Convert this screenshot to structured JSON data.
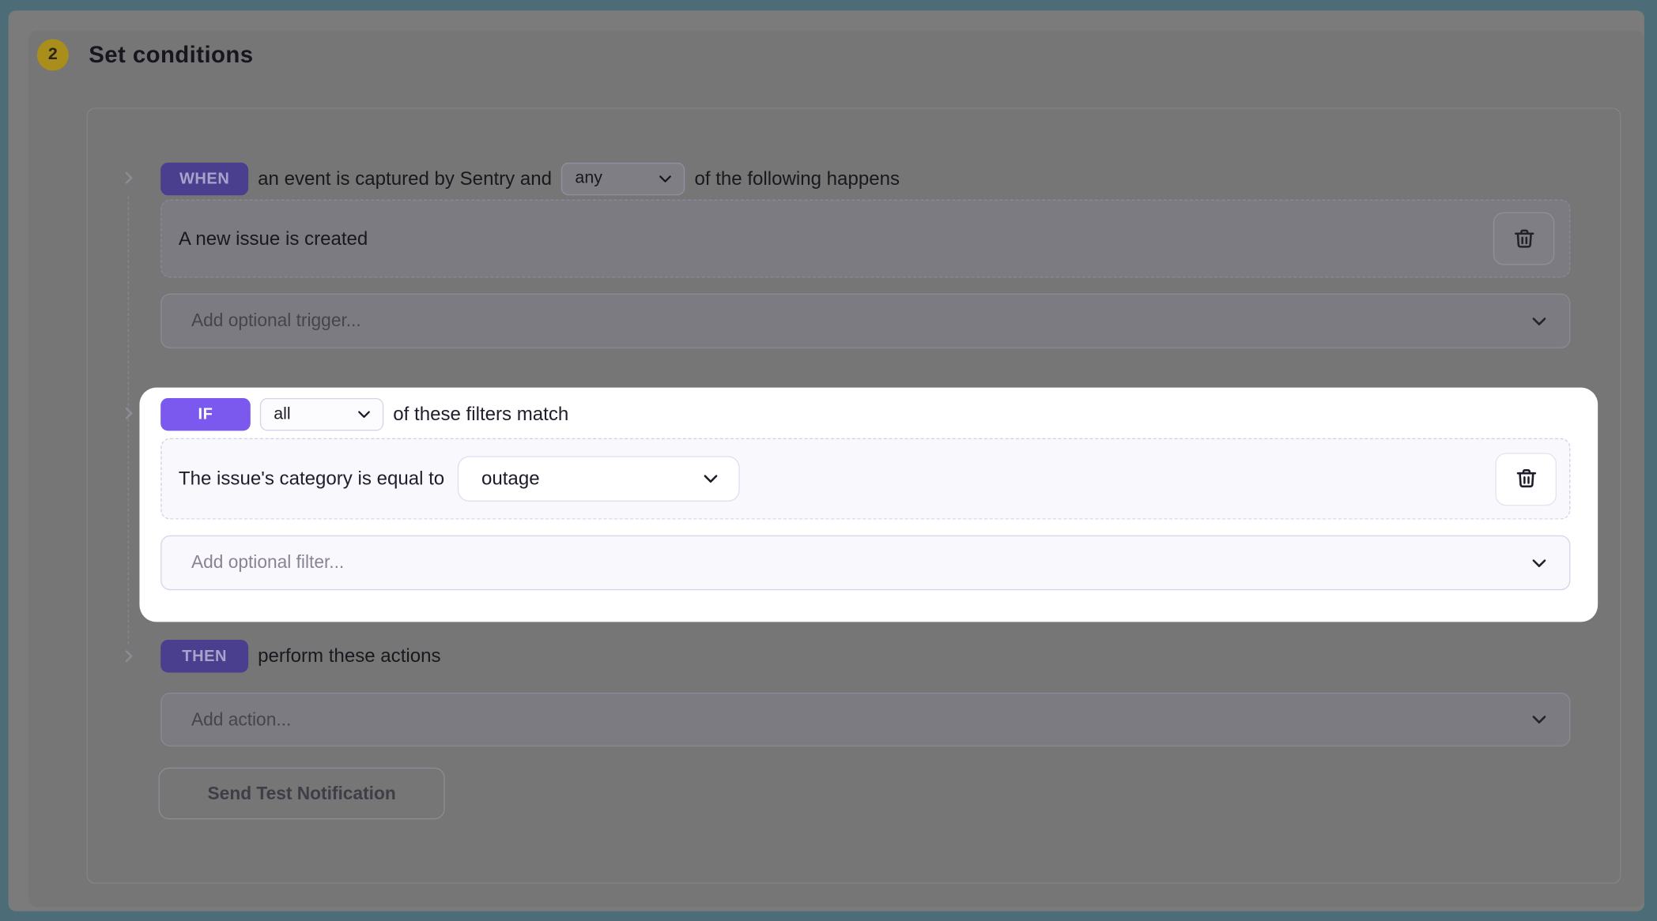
{
  "colors": {
    "frame_teal": "#4c6d78",
    "accent_purple": "#7b58ee",
    "dim_badge_purple": "#4a3f8f",
    "step_badge_yellow": "#a98e1b",
    "spotlight_white": "#ffffff"
  },
  "icons": {
    "collapse_caret": "chevron-right-icon",
    "select_arrow": "chevron-down-icon",
    "delete": "trash-icon"
  },
  "header": {
    "step_number": "2",
    "title": "Set conditions"
  },
  "when": {
    "badge": "WHEN",
    "text_before": "an event is captured by Sentry and",
    "match_select": "any",
    "text_after": "of the following happens",
    "conditions": [
      {
        "label": "A new issue is created"
      }
    ],
    "add_placeholder": "Add optional trigger..."
  },
  "if": {
    "badge": "IF",
    "match_select": "all",
    "text_after": "of these filters match",
    "filters": [
      {
        "label": "The issue's category is equal to",
        "value_select": "outage"
      }
    ],
    "add_placeholder": "Add optional filter..."
  },
  "then": {
    "badge": "THEN",
    "text_after": "perform these actions",
    "add_placeholder": "Add action...",
    "test_button_label": "Send Test Notification"
  }
}
